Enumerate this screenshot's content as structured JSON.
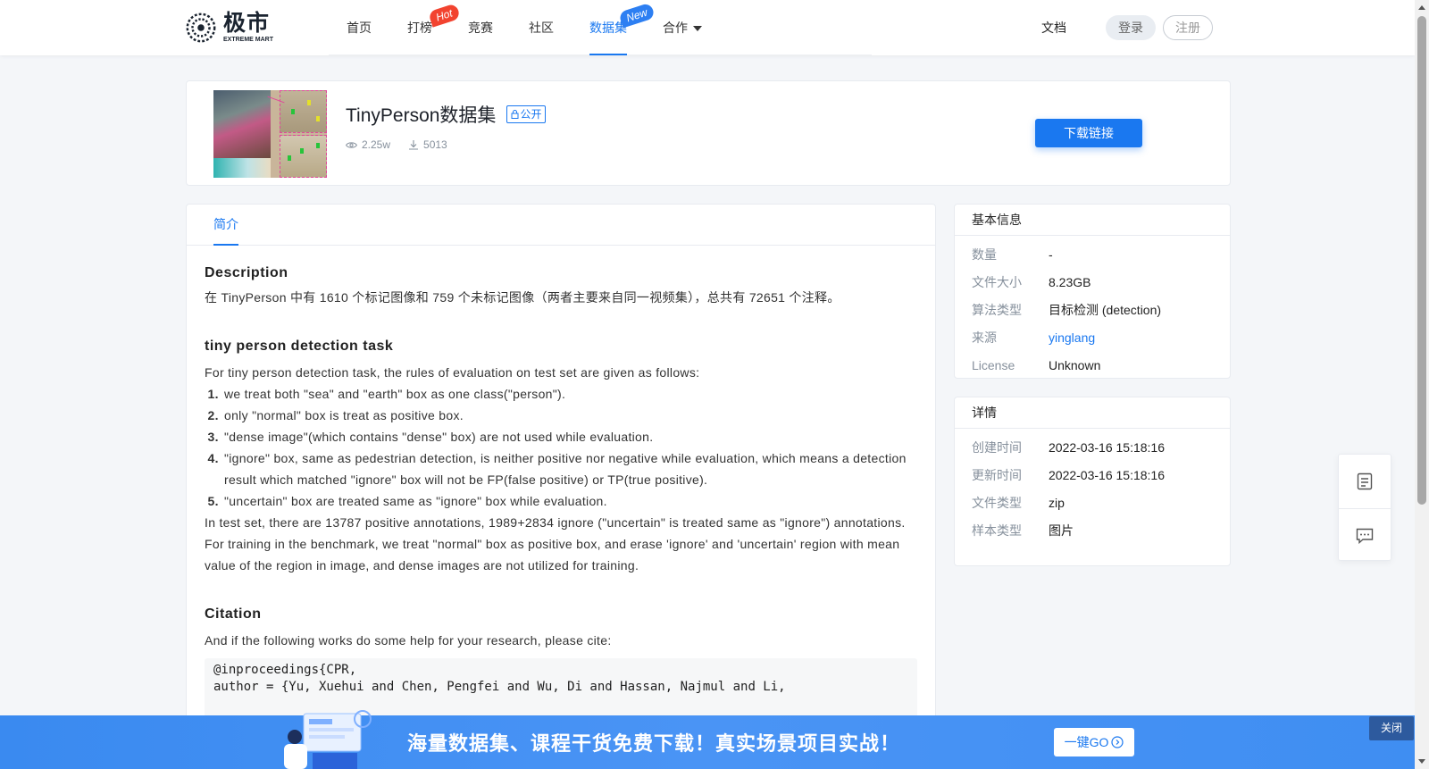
{
  "brand": {
    "name_cn": "极市",
    "name_en": "EXTREME MART"
  },
  "nav": {
    "items": [
      {
        "label": "首页"
      },
      {
        "label": "打榜",
        "badge": "Hot"
      },
      {
        "label": "竞赛"
      },
      {
        "label": "社区"
      },
      {
        "label": "数据集",
        "badge": "New",
        "active": true
      },
      {
        "label": "合作"
      }
    ],
    "docs": "文档",
    "login": "登录",
    "register": "注册"
  },
  "dataset": {
    "title": "TinyPerson数据集",
    "visibility": "公开",
    "views": "2.25w",
    "downloads": "5013",
    "download_button": "下载链接"
  },
  "tabs": {
    "intro": "简介"
  },
  "content": {
    "description_heading": "Description",
    "description_text": "在 TinyPerson 中有 1610 个标记图像和 759 个未标记图像（两者主要来自同一视频集），总共有 72651 个注释。",
    "task_heading": "tiny person detection task",
    "task_intro": "For tiny person detection task, the rules of evaluation on test set are given as follows:",
    "rules": [
      "we treat both \"sea\" and \"earth\" box as one class(\"person\").",
      "only \"normal\" box is treat as positive box.",
      "\"dense image\"(which contains \"dense\" box) are not used while evaluation.",
      "\"ignore\" box, same as pedestrian detection, is neither positive nor negative while evaluation, which means a detection result which matched \"ignore\" box will not be FP(false positive) or TP(true positive).",
      "\"uncertain\" box are treated same as \"ignore\" box while evaluation."
    ],
    "task_summary": "In test set, there are 13787 positive annotations, 1989+2834 ignore (\"uncertain\" is treated same as \"ignore\") annotations. For training in the benchmark, we treat \"normal\" box as positive box, and erase 'ignore' and 'uncertain' region with mean value of the region in image, and dense images are not utilized for training.",
    "citation_heading": "Citation",
    "citation_intro": "And if the following works do some help for your research, please cite:",
    "code_lines": [
      "@inproceedings{CPR,",
      "author = {Yu, Xuehui and Chen, Pengfei and Wu, Di and Hassan, Najmul and Li,"
    ]
  },
  "basic_info": {
    "heading": "基本信息",
    "rows": [
      {
        "key": "数量",
        "value": "-"
      },
      {
        "key": "文件大小",
        "value": "8.23GB"
      },
      {
        "key": "算法类型",
        "value": "目标检测 (detection)"
      },
      {
        "key": "来源",
        "value": "yinglang",
        "link": true
      },
      {
        "key": "License",
        "value": "Unknown"
      }
    ]
  },
  "details": {
    "heading": "详情",
    "rows": [
      {
        "key": "创建时间",
        "value": "2022-03-16 15:18:16"
      },
      {
        "key": "更新时间",
        "value": "2022-03-16 15:18:16"
      },
      {
        "key": "文件类型",
        "value": "zip"
      },
      {
        "key": "样本类型",
        "value": "图片"
      }
    ]
  },
  "banner": {
    "text": "海量数据集、课程干货免费下载！真实场景项目实战！",
    "go_button": "一键GO",
    "close": "关闭"
  },
  "colors": {
    "accent": "#1a78f0",
    "hot": "#f2432f",
    "new": "#2d7ff2",
    "banner": "#4a94f5"
  },
  "icons": [
    "logo-icon",
    "eye-icon",
    "download-icon",
    "lock-icon",
    "document-icon",
    "chat-icon",
    "arrow-circle-icon",
    "caret-down-icon"
  ]
}
